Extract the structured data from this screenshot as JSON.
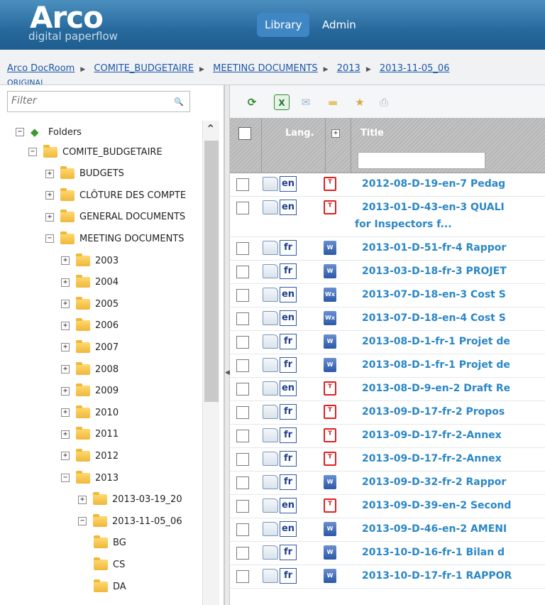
{
  "header": {
    "logo_word": "Arco",
    "logo_sub": "digital paperflow",
    "nav": [
      {
        "label": "Library",
        "active": true
      },
      {
        "label": "Admin",
        "active": false
      }
    ]
  },
  "breadcrumb": {
    "items": [
      "Arco DocRoom",
      "COMITE_BUDGETAIRE",
      "MEETING DOCUMENTS",
      "2013",
      "2013-11-05_06"
    ],
    "overflow": "ORIGINAL"
  },
  "sidebar": {
    "filter_placeholder": "Filter",
    "root": "Folders",
    "nodes": [
      {
        "label": "COMITE_BUDGETAIRE",
        "toggle": "−"
      },
      {
        "label": "BUDGETS",
        "toggle": "+"
      },
      {
        "label": "CLÔTURE DES COMPTE",
        "toggle": "+"
      },
      {
        "label": "GENERAL DOCUMENTS",
        "toggle": "+"
      },
      {
        "label": "MEETING DOCUMENTS",
        "toggle": "−"
      },
      {
        "label": "2003",
        "toggle": "+"
      },
      {
        "label": "2004",
        "toggle": "+"
      },
      {
        "label": "2005",
        "toggle": "+"
      },
      {
        "label": "2006",
        "toggle": "+"
      },
      {
        "label": "2007",
        "toggle": "+"
      },
      {
        "label": "2008",
        "toggle": "+"
      },
      {
        "label": "2009",
        "toggle": "+"
      },
      {
        "label": "2010",
        "toggle": "+"
      },
      {
        "label": "2011",
        "toggle": "+"
      },
      {
        "label": "2012",
        "toggle": "+"
      },
      {
        "label": "2013",
        "toggle": "−"
      },
      {
        "label": "2013-03-19_20",
        "toggle": "+"
      },
      {
        "label": "2013-11-05_06",
        "toggle": "−"
      },
      {
        "label": "BG",
        "toggle": ""
      },
      {
        "label": "CS",
        "toggle": ""
      },
      {
        "label": "DA",
        "toggle": ""
      }
    ]
  },
  "table": {
    "headers": {
      "lang": "Lang.",
      "expand": "+",
      "title": "Title"
    },
    "rows": [
      {
        "lang": "en",
        "type": "pdf",
        "title": "2012-08-D-19-en-7 Pedag",
        "title2": ""
      },
      {
        "lang": "en",
        "type": "pdf",
        "title": "2013-01-D-43-en-3 QUALI",
        "title2": "for Inspectors f..."
      },
      {
        "lang": "fr",
        "type": "word",
        "title": "2013-01-D-51-fr-4 Rappor",
        "title2": ""
      },
      {
        "lang": "fr",
        "type": "word",
        "title": "2013-03-D-18-fr-3 PROJET",
        "title2": ""
      },
      {
        "lang": "en",
        "type": "wordx",
        "title": "2013-07-D-18-en-3 Cost S",
        "title2": ""
      },
      {
        "lang": "en",
        "type": "wordx",
        "title": "2013-07-D-18-en-4 Cost S",
        "title2": ""
      },
      {
        "lang": "fr",
        "type": "word",
        "title": "2013-08-D-1-fr-1 Projet de",
        "title2": ""
      },
      {
        "lang": "fr",
        "type": "word",
        "title": "2013-08-D-1-fr-1 Projet de",
        "title2": ""
      },
      {
        "lang": "en",
        "type": "pdf",
        "title": "2013-08-D-9-en-2 Draft Re",
        "title2": ""
      },
      {
        "lang": "fr",
        "type": "pdf",
        "title": "2013-09-D-17-fr-2 Propos",
        "title2": ""
      },
      {
        "lang": "fr",
        "type": "pdf",
        "title": "2013-09-D-17-fr-2-Annex",
        "title2": ""
      },
      {
        "lang": "fr",
        "type": "pdf",
        "title": "2013-09-D-17-fr-2-Annex",
        "title2": ""
      },
      {
        "lang": "fr",
        "type": "word",
        "title": "2013-09-D-32-fr-2 Rappor",
        "title2": ""
      },
      {
        "lang": "en",
        "type": "pdf",
        "title": "2013-09-D-39-en-2 Second",
        "title2": ""
      },
      {
        "lang": "en",
        "type": "word",
        "title": "2013-09-D-46-en-2 AMENI",
        "title2": ""
      },
      {
        "lang": "fr",
        "type": "word",
        "title": "2013-10-D-16-fr-1 Bilan d",
        "title2": ""
      },
      {
        "lang": "fr",
        "type": "word",
        "title": "2013-10-D-17-fr-1 RAPPOR",
        "title2": ""
      }
    ]
  },
  "toolbar": {
    "icons": [
      "refresh-icon",
      "excel-export-icon",
      "email-icon",
      "folder-icon",
      "bookmark-icon",
      "print-icon"
    ]
  },
  "colors": {
    "header": "#2b6d9f",
    "nav_active": "#3f86c5",
    "title_link": "#2a87c7",
    "breadcrumb": "#1d57a8",
    "lang_border": "#2f58a8"
  }
}
